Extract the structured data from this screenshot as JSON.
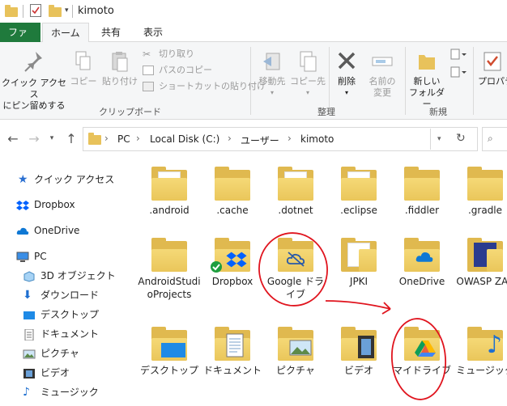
{
  "window": {
    "title": "kimoto"
  },
  "tabs": {
    "file": "ファイル",
    "home": "ホーム",
    "share": "共有",
    "view": "表示"
  },
  "ribbon": {
    "pin_label": "クイック アクセス\nにピン留めする",
    "copy_label": "コピー",
    "paste_label": "貼り付け",
    "cut_label": "切り取り",
    "copy_path_label": "パスのコピー",
    "paste_shortcut_label": "ショートカットの貼り付け",
    "clipboard_group": "クリップボード",
    "move_to_label": "移動先",
    "copy_to_label": "コピー先",
    "delete_label": "削除",
    "rename_label": "名前の\n変更",
    "organize_group": "整理",
    "new_folder_label": "新しい\nフォルダー",
    "new_group": "新規",
    "properties_label": "プロパテ"
  },
  "address": {
    "crumbs": [
      "PC",
      "Local Disk (C:)",
      "ユーザー",
      "kimoto"
    ]
  },
  "sidebar": {
    "items": [
      "クイック アクセス",
      "Dropbox",
      "OneDrive",
      "PC",
      "3D オブジェクト",
      "ダウンロード",
      "デスクトップ",
      "ドキュメント",
      "ピクチャ",
      "ビデオ",
      "ミュージック"
    ]
  },
  "content": {
    "row1": [
      ".android",
      ".cache",
      ".dotnet",
      ".eclipse",
      ".fiddler",
      ".gradle"
    ],
    "row2": [
      "AndroidStudioProjects",
      "Dropbox",
      "Google ドライブ",
      "JPKI",
      "OneDrive",
      "OWASP ZAP"
    ],
    "row3": [
      "デスクトップ",
      "ドキュメント",
      "ピクチャ",
      "ビデオ",
      "マイドライブ",
      "ミュージック"
    ]
  },
  "colors": {
    "file_tab": "#1f7a3c",
    "annotation": "#e0141e",
    "folder": "#e0b94f"
  }
}
